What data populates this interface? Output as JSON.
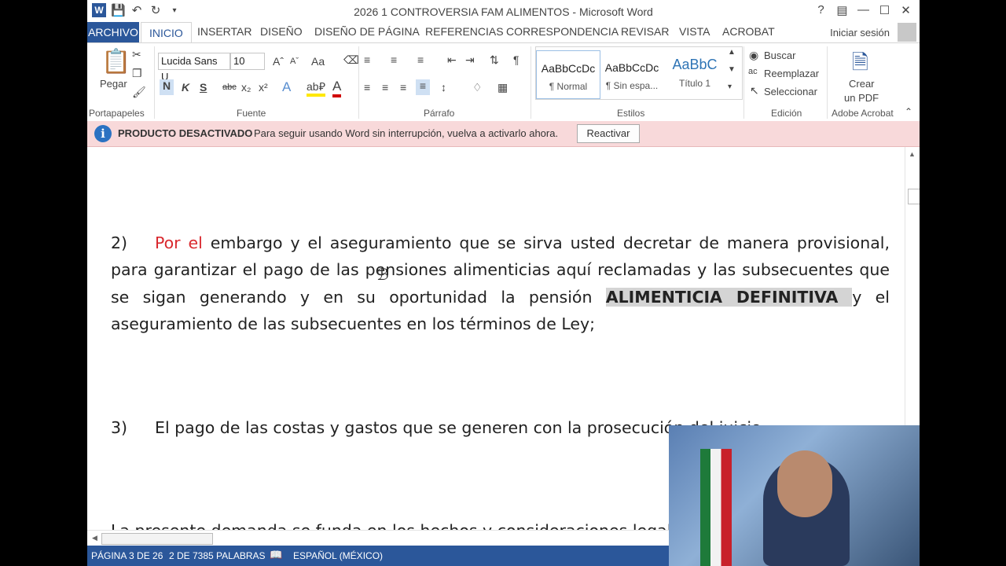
{
  "window": {
    "title": "2026 1 CONTROVERSIA FAM ALIMENTOS - Microsoft Word",
    "app_logo": "W"
  },
  "tabs": {
    "file": "ARCHIVO",
    "items": [
      "INICIO",
      "INSERTAR",
      "DISEÑO",
      "DISEÑO DE PÁGINA",
      "REFERENCIAS",
      "CORRESPONDENCIA",
      "REVISAR",
      "VISTA",
      "ACROBAT"
    ],
    "active": "INICIO",
    "signin": "Iniciar sesión"
  },
  "ribbon": {
    "clipboard": {
      "paste_label": "Pegar",
      "group": "Portapapeles"
    },
    "font": {
      "name": "Lucida Sans U",
      "size": "10",
      "change_case": "Aa",
      "bold": "N",
      "italic": "K",
      "underline": "S",
      "strike": "abc",
      "subscript": "x₂",
      "superscript": "x²",
      "group": "Fuente"
    },
    "paragraph": {
      "group": "Párrafo"
    },
    "styles": {
      "items": [
        {
          "preview": "AaBbCcDc",
          "name": "¶ Normal"
        },
        {
          "preview": "AaBbCcDc",
          "name": "¶ Sin espa..."
        },
        {
          "preview": "AaBbC",
          "name": "Título 1"
        }
      ],
      "group": "Estilos"
    },
    "editing": {
      "find": "Buscar",
      "replace": "Reemplazar",
      "select": "Seleccionar",
      "group": "Edición"
    },
    "acrobat": {
      "create_pdf_line1": "Crear",
      "create_pdf_line2": "un PDF",
      "group": "Adobe Acrobat"
    }
  },
  "banner": {
    "heading": "PRODUCTO DESACTIVADO",
    "message": "Para seguir usando Word sin interrupción, vuelva a activarlo ahora.",
    "button": "Reactivar"
  },
  "document": {
    "p2": {
      "number": "2)",
      "red_lead": "Por el",
      "text_a": " embargo y el aseguramiento que se sirva usted decretar de manera provisional, para garantizar el pago de las pensiones alimenticias aquí reclamadas y las subsecuentes que se sigan generando y en su oportunidad la pensión ",
      "highlight": "ALIMENTICIA DEFINITIVA ",
      "text_b": "y el aseguramiento de las subsecuentes en los términos de Ley;"
    },
    "p3": {
      "number": "3)",
      "text": "El pago de las costas y gastos que se generen con la prosecución del juicio."
    },
    "p4": {
      "text": "La presente demanda se funda en los hechos y consideraciones legales siguientes:"
    }
  },
  "status": {
    "page": "PÁGINA 3 DE 26",
    "words": "2 DE 7385 PALABRAS",
    "language": "ESPAÑOL (MÉXICO)"
  },
  "colors": {
    "accent": "#2b579a",
    "banner_bg": "#f8d9da",
    "red_text": "#d9282e"
  }
}
